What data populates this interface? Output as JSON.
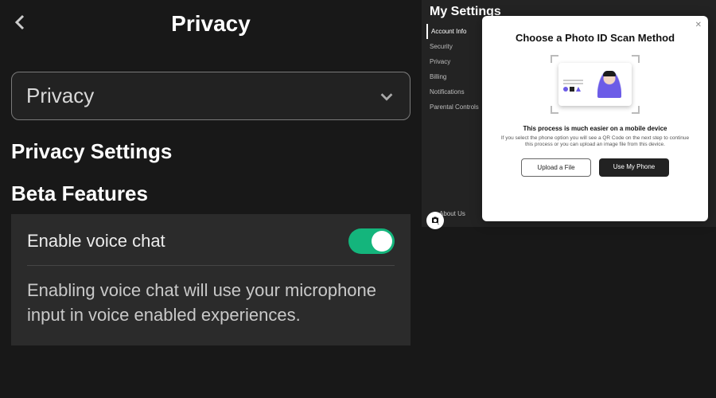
{
  "left": {
    "title": "Privacy",
    "dropdown_label": "Privacy",
    "section_heading": "Privacy Settings",
    "subsection_heading": "Beta Features",
    "toggle_label": "Enable voice chat",
    "toggle_on": true,
    "toggle_description": "Enabling voice chat will use your microphone input in voice enabled experiences."
  },
  "right": {
    "title": "My Settings",
    "menu": [
      "Account Info",
      "Security",
      "Privacy",
      "Billing",
      "Notifications",
      "Parental Controls"
    ],
    "footer": [
      "About Us"
    ]
  },
  "modal": {
    "title": "Choose a Photo ID Scan Method",
    "lead": "This process is much easier on a mobile device",
    "subtext": "If you select the phone option you will see a QR Code on the next step to continue this process or you can upload an image file from this device.",
    "btn_upload": "Upload a File",
    "btn_phone": "Use My Phone"
  }
}
